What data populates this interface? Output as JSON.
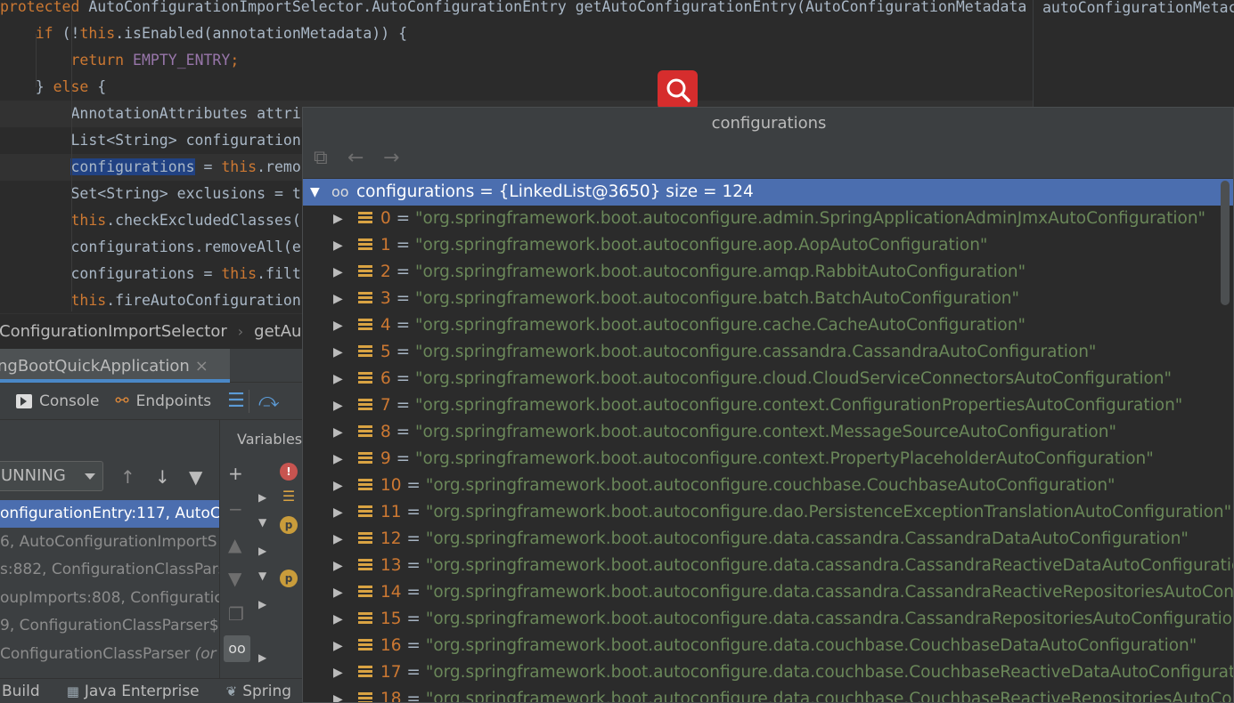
{
  "editor": {
    "lines": [
      {
        "parts": [
          {
            "t": "protected ",
            "c": "kw"
          },
          {
            "t": "AutoConfigurationImportSelector.AutoConfigurationEntry getAutoConfigurationEntry(AutoConfigurationMetadata autoConfigurationMetadata,",
            "c": ""
          }
        ]
      },
      {
        "parts": [
          {
            "t": "    ",
            "c": ""
          },
          {
            "t": "if ",
            "c": "kw"
          },
          {
            "t": "(!",
            "c": ""
          },
          {
            "t": "this",
            "c": "kw"
          },
          {
            "t": ".isEnabled(annotationMetadata)) {",
            "c": ""
          }
        ]
      },
      {
        "parts": [
          {
            "t": "        ",
            "c": ""
          },
          {
            "t": "return ",
            "c": "kw"
          },
          {
            "t": "EMPTY_ENTRY",
            "c": "ident"
          },
          {
            "t": ";",
            "c": "kw"
          }
        ]
      },
      {
        "parts": [
          {
            "t": "    } ",
            "c": ""
          },
          {
            "t": "else ",
            "c": "kw"
          },
          {
            "t": "{",
            "c": ""
          }
        ]
      },
      {
        "parts": [
          {
            "t": "        AnnotationAttributes attri",
            "c": ""
          }
        ]
      },
      {
        "parts": [
          {
            "t": "        List<String> configuration",
            "c": ""
          }
        ]
      },
      {
        "parts": [
          {
            "t": "        ",
            "c": ""
          },
          {
            "t": "configurations",
            "c": "sel"
          },
          {
            "t": " = ",
            "c": ""
          },
          {
            "t": "this",
            "c": "kw"
          },
          {
            "t": ".remo",
            "c": ""
          }
        ]
      },
      {
        "parts": [
          {
            "t": "        Set<String> exclusions = t",
            "c": ""
          }
        ]
      },
      {
        "parts": [
          {
            "t": "        ",
            "c": ""
          },
          {
            "t": "this",
            "c": "kw"
          },
          {
            "t": ".checkExcludedClasses(",
            "c": ""
          }
        ]
      },
      {
        "parts": [
          {
            "t": "        configurations.removeAll(e",
            "c": ""
          }
        ]
      },
      {
        "parts": [
          {
            "t": "        configurations = ",
            "c": ""
          },
          {
            "t": "this",
            "c": "kw"
          },
          {
            "t": ".filt",
            "c": ""
          }
        ]
      },
      {
        "parts": [
          {
            "t": "        ",
            "c": ""
          },
          {
            "t": "this",
            "c": "kw"
          },
          {
            "t": ".fireAutoConfiguration",
            "c": ""
          }
        ]
      }
    ]
  },
  "breadcrumb": {
    "items": [
      "oConfigurationImportSelector",
      "getAu"
    ],
    "separator": "›"
  },
  "run_tab": {
    "label": "ingBootQuickApplication",
    "close": "×"
  },
  "debug_toolbar": {
    "console": "Console",
    "endpoints": "Endpoints"
  },
  "frames": {
    "thread_state": "UNNING",
    "rows": [
      {
        "text": "onfigurationEntry:117, AutoC",
        "selected": true
      },
      {
        "text": "6, AutoConfigurationImportS",
        "selected": false
      },
      {
        "text": "s:882, ConfigurationClassPars",
        "selected": false
      },
      {
        "text": "oupImports:808, Configuratic",
        "selected": false
      },
      {
        "text": "9, ConfigurationClassParser$",
        "selected": false
      },
      {
        "text": "ConfigurationClassParser ",
        "italic": "(or",
        "selected": false
      }
    ]
  },
  "variables": {
    "title": "Variables"
  },
  "bottom_bar": {
    "build": "Build",
    "java_enterprise": "Java Enterprise",
    "spring": "Spring"
  },
  "hint_col": {
    "text": "autoConfigurationMetac"
  },
  "popup": {
    "title": "configurations",
    "root": "configurations = {LinkedList@3650}  size = 124",
    "items": [
      {
        "i": "0",
        "v": "\"org.springframework.boot.autoconfigure.admin.SpringApplicationAdminJmxAutoConfiguration\""
      },
      {
        "i": "1",
        "v": "\"org.springframework.boot.autoconfigure.aop.AopAutoConfiguration\""
      },
      {
        "i": "2",
        "v": "\"org.springframework.boot.autoconfigure.amqp.RabbitAutoConfiguration\""
      },
      {
        "i": "3",
        "v": "\"org.springframework.boot.autoconfigure.batch.BatchAutoConfiguration\""
      },
      {
        "i": "4",
        "v": "\"org.springframework.boot.autoconfigure.cache.CacheAutoConfiguration\""
      },
      {
        "i": "5",
        "v": "\"org.springframework.boot.autoconfigure.cassandra.CassandraAutoConfiguration\""
      },
      {
        "i": "6",
        "v": "\"org.springframework.boot.autoconfigure.cloud.CloudServiceConnectorsAutoConfiguration\""
      },
      {
        "i": "7",
        "v": "\"org.springframework.boot.autoconfigure.context.ConfigurationPropertiesAutoConfiguration\""
      },
      {
        "i": "8",
        "v": "\"org.springframework.boot.autoconfigure.context.MessageSourceAutoConfiguration\""
      },
      {
        "i": "9",
        "v": "\"org.springframework.boot.autoconfigure.context.PropertyPlaceholderAutoConfiguration\""
      },
      {
        "i": "10",
        "v": "\"org.springframework.boot.autoconfigure.couchbase.CouchbaseAutoConfiguration\""
      },
      {
        "i": "11",
        "v": "\"org.springframework.boot.autoconfigure.dao.PersistenceExceptionTranslationAutoConfiguration\""
      },
      {
        "i": "12",
        "v": "\"org.springframework.boot.autoconfigure.data.cassandra.CassandraDataAutoConfiguration\""
      },
      {
        "i": "13",
        "v": "\"org.springframework.boot.autoconfigure.data.cassandra.CassandraReactiveDataAutoConfiguration\""
      },
      {
        "i": "14",
        "v": "\"org.springframework.boot.autoconfigure.data.cassandra.CassandraReactiveRepositoriesAutoConfiguration\""
      },
      {
        "i": "15",
        "v": "\"org.springframework.boot.autoconfigure.data.cassandra.CassandraRepositoriesAutoConfiguration\""
      },
      {
        "i": "16",
        "v": "\"org.springframework.boot.autoconfigure.data.couchbase.CouchbaseDataAutoConfiguration\""
      },
      {
        "i": "17",
        "v": "\"org.springframework.boot.autoconfigure.data.couchbase.CouchbaseReactiveDataAutoConfiguration\""
      },
      {
        "i": "18",
        "v": "\"org.springframework.boot.autoconfigure.data.couchbase.CouchbaseReactiveRepositoriesAutoConfiguration\""
      }
    ]
  },
  "colors": {
    "keyword": "#cc7832",
    "string": "#6a8759",
    "selection": "#4b6eaf",
    "search_badge": "#d62d2d"
  },
  "icons": {
    "search": "search-icon",
    "list": "list-icon",
    "watch": "glasses-icon"
  }
}
